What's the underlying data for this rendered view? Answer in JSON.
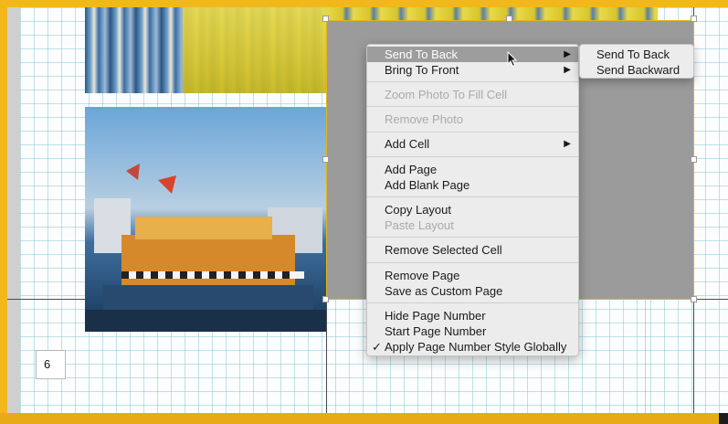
{
  "page": {
    "number": "6"
  },
  "context_menu": {
    "items": [
      {
        "label": "Send To Back",
        "submenu": true,
        "highlighted": true
      },
      {
        "label": "Bring To Front",
        "submenu": true
      },
      {
        "label": "Zoom Photo To Fill Cell",
        "disabled": true
      },
      {
        "label": "Remove Photo",
        "disabled": true
      },
      {
        "label": "Add Cell",
        "submenu": true
      },
      {
        "label": "Add Page"
      },
      {
        "label": "Add Blank Page"
      },
      {
        "label": "Copy Layout"
      },
      {
        "label": "Paste Layout",
        "disabled": true
      },
      {
        "label": "Remove Selected Cell"
      },
      {
        "label": "Remove Page"
      },
      {
        "label": "Save as Custom Page"
      },
      {
        "label": "Hide Page Number"
      },
      {
        "label": "Start Page Number"
      },
      {
        "label": "Apply Page Number Style Globally",
        "checked": true
      }
    ],
    "submenu_arrow": "▶",
    "checkmark": "✓"
  },
  "submenu": {
    "items": [
      {
        "label": "Send To Back"
      },
      {
        "label": "Send Backward"
      }
    ]
  },
  "colors": {
    "frame_accent": "#f2b81b",
    "menu_highlight": "#9d9d9d",
    "grid_line": "#78becd",
    "cell_placeholder": "#9b9b9b"
  }
}
